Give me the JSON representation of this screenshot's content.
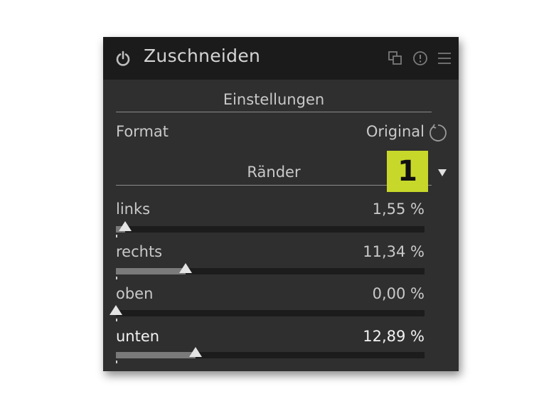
{
  "module": {
    "title": "Zuschneiden",
    "icons": [
      "power-icon",
      "presets-icon",
      "info-icon",
      "menu-icon"
    ]
  },
  "settings": {
    "section_title": "Einstellungen",
    "format_label": "Format",
    "format_value": "Original"
  },
  "margins": {
    "section_title": "Ränder",
    "badge": "1",
    "sliders": [
      {
        "label": "links",
        "value": "1,55 %",
        "fraction": 0.0155
      },
      {
        "label": "rechts",
        "value": "11,34 %",
        "fraction": 0.1134
      },
      {
        "label": "oben",
        "value": "0,00 %",
        "fraction": 0.0
      },
      {
        "label": "unten",
        "value": "12,89 %",
        "fraction": 0.1289
      }
    ]
  },
  "colors": {
    "badge": "#c7d82a",
    "panel": "#2f2f2f",
    "header": "#1b1b1b"
  }
}
